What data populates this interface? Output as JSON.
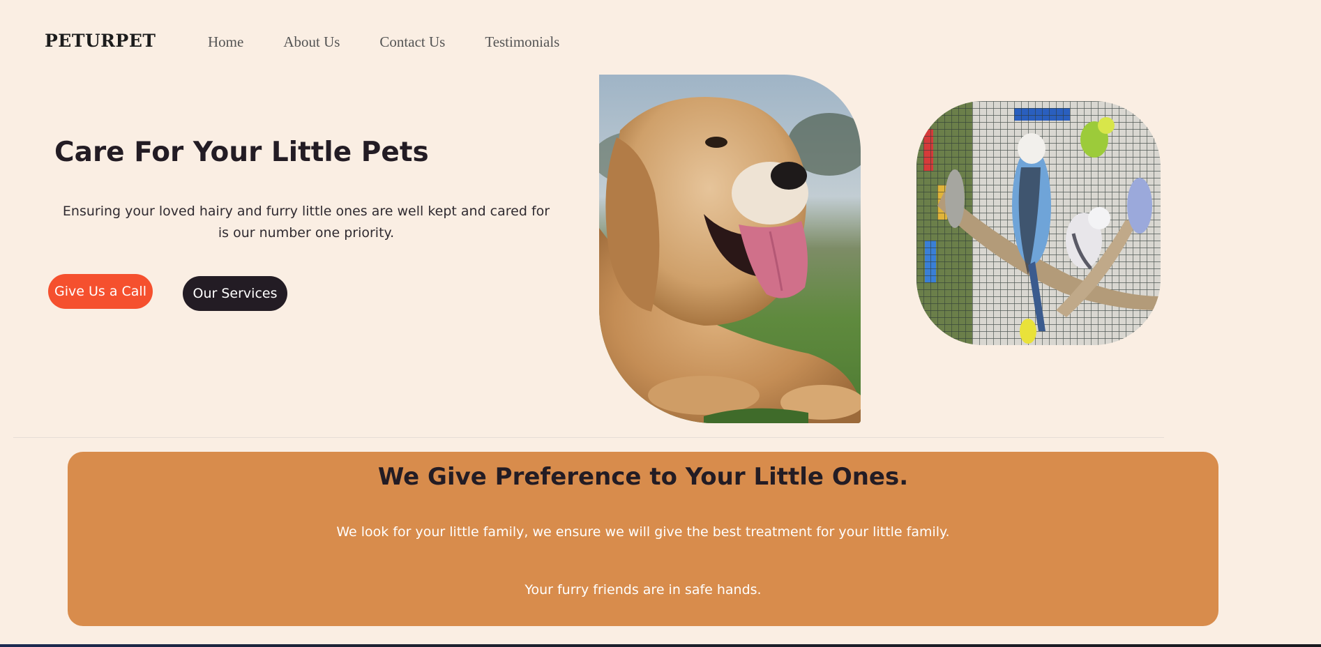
{
  "header": {
    "brand": "PETURPET",
    "nav": [
      "Home",
      "About Us",
      "Contact Us",
      "Testimonials"
    ]
  },
  "hero": {
    "title": "Care For Your Little Pets",
    "text": "Ensuring your loved hairy and furry little ones are well kept and cared for is our number one priority.",
    "call_button": "Give Us a Call",
    "services_button": "Our Services"
  },
  "banner": {
    "title": "We Give Preference to Your Little Ones.",
    "text_1": "We look for your little family, we ensure we will give the best treatment for your little family.",
    "text_2": "Your furry friends are in safe hands."
  },
  "colors": {
    "page_background": "#FAEEE3",
    "primary_dark": "#231C24",
    "accent_orange": "#F5502E",
    "banner_background": "#D88C4C"
  }
}
